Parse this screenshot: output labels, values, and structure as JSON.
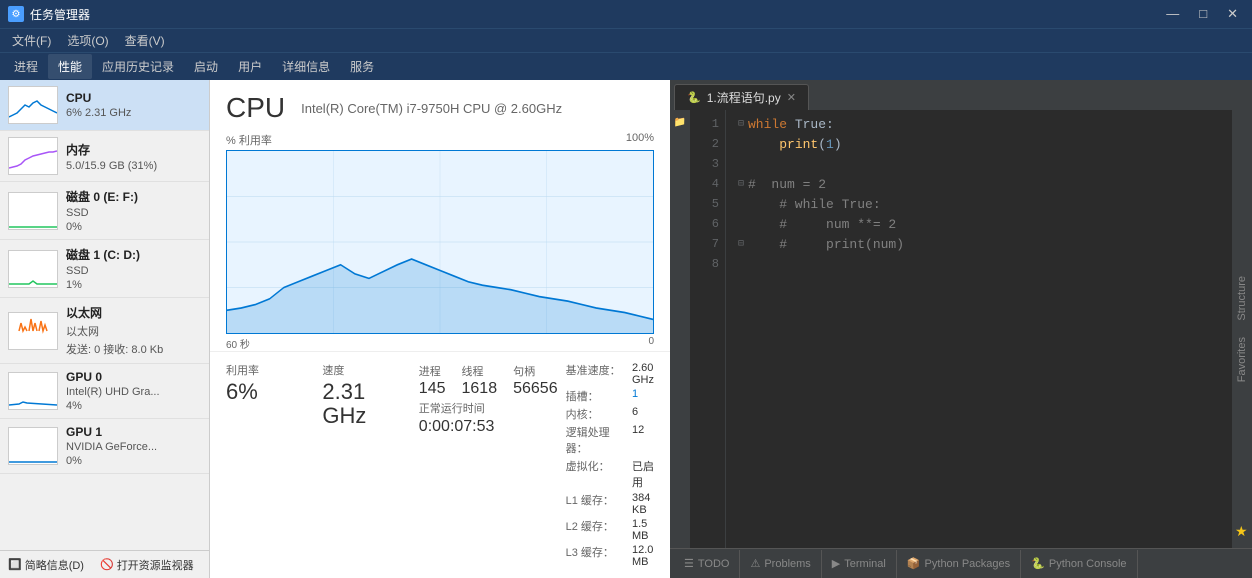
{
  "titlebar": {
    "icon": "⚙",
    "title": "任务管理器",
    "minimize": "—",
    "maximize": "□",
    "close": "✕"
  },
  "menubar": {
    "items": [
      "文件(F)",
      "选项(O)",
      "查看(V)"
    ]
  },
  "tabbar": {
    "items": [
      "进程",
      "性能",
      "应用历史记录",
      "启动",
      "用户",
      "详细信息",
      "服务"
    ],
    "active": "性能"
  },
  "sidebar": {
    "items": [
      {
        "name": "CPU",
        "detail": "6%  2.31 GHz",
        "type": "cpu"
      },
      {
        "name": "内存",
        "detail": "5.0/15.9 GB (31%)",
        "type": "mem"
      },
      {
        "name": "磁盘 0 (E: F:)",
        "detail": "SSD\n0%",
        "detail1": "SSD",
        "detail2": "0%",
        "type": "disk0"
      },
      {
        "name": "磁盘 1 (C: D:)",
        "detail": "SSD\n1%",
        "detail1": "SSD",
        "detail2": "1%",
        "type": "disk1"
      },
      {
        "name": "以太网",
        "detail1": "以太网",
        "detail2": "发送: 0  接收: 8.0 Kb",
        "type": "eth"
      },
      {
        "name": "GPU 0",
        "detail1": "Intel(R) UHD Gra...",
        "detail2": "4%",
        "type": "gpu0"
      },
      {
        "name": "GPU 1",
        "detail1": "NVIDIA GeForce...",
        "detail2": "0%",
        "type": "gpu1"
      }
    ],
    "active": 0
  },
  "cpu_detail": {
    "title": "CPU",
    "subtitle": "Intel(R) Core(TM) i7-9750H CPU @ 2.60GHz",
    "graph_label": "% 利用率",
    "graph_max": "100%",
    "graph_time": "60 秒",
    "graph_end": "0",
    "stats": {
      "utilization_label": "利用率",
      "utilization_value": "6%",
      "speed_label": "速度",
      "speed_value": "2.31 GHz",
      "process_label": "进程",
      "process_value": "145",
      "thread_label": "线程",
      "thread_value": "1618",
      "handle_label": "句柄",
      "handle_value": "56656",
      "uptime_label": "正常运行时间",
      "uptime_value": "0:00:07:53"
    },
    "details": {
      "base_speed_label": "基准速度：",
      "base_speed_value": "2.60 GHz",
      "slots_label": "插槽：",
      "slots_value": "1",
      "cores_label": "内核：",
      "cores_value": "6",
      "proc_label": "逻辑处理器：",
      "proc_value": "12",
      "virt_label": "虚拟化：",
      "virt_value": "已启用",
      "l1_label": "L1 缓存：",
      "l1_value": "384 KB",
      "l2_label": "L2 缓存：",
      "l2_value": "1.5 MB",
      "l3_label": "L3 缓存：",
      "l3_value": "12.0 MB"
    }
  },
  "footer": {
    "summary": "简略信息(D)",
    "open_monitor": "打开资源监视器"
  },
  "pycharm": {
    "tab": {
      "icon": "🐍",
      "name": "1.流程语句.py",
      "close": "✕"
    },
    "lines": [
      {
        "num": "1",
        "tokens": [
          {
            "t": "kw",
            "v": "while"
          },
          {
            "t": "op",
            "v": " "
          },
          {
            "t": "builtin",
            "v": "True"
          },
          {
            "t": "op",
            "v": ":"
          }
        ],
        "fold": ""
      },
      {
        "num": "2",
        "tokens": [
          {
            "t": "op",
            "v": "        "
          },
          {
            "t": "fn",
            "v": "print"
          },
          {
            "t": "op",
            "v": "("
          },
          {
            "t": "num",
            "v": "1"
          },
          {
            "t": "op",
            "v": ")"
          }
        ],
        "fold": ""
      },
      {
        "num": "3",
        "tokens": [],
        "fold": ""
      },
      {
        "num": "4",
        "tokens": [
          {
            "t": "comment",
            "v": "#  num = 2"
          }
        ],
        "fold": "⊟"
      },
      {
        "num": "5",
        "tokens": [
          {
            "t": "comment",
            "v": "    # while True:"
          }
        ],
        "fold": ""
      },
      {
        "num": "6",
        "tokens": [
          {
            "t": "comment",
            "v": "    #     num **= 2"
          }
        ],
        "fold": ""
      },
      {
        "num": "7",
        "tokens": [
          {
            "t": "comment",
            "v": "    #     print(num)"
          }
        ],
        "fold": "⊟"
      },
      {
        "num": "8",
        "tokens": [],
        "fold": ""
      }
    ],
    "right_sidebar": [
      "Structure",
      "Favorites"
    ],
    "bottom_tabs": [
      {
        "icon": "☰",
        "label": "TODO"
      },
      {
        "icon": "⚠",
        "label": "Problems"
      },
      {
        "icon": "▶",
        "label": "Terminal"
      },
      {
        "icon": "📦",
        "label": "Python Packages"
      },
      {
        "icon": "🐍",
        "label": "Python Console"
      }
    ]
  }
}
